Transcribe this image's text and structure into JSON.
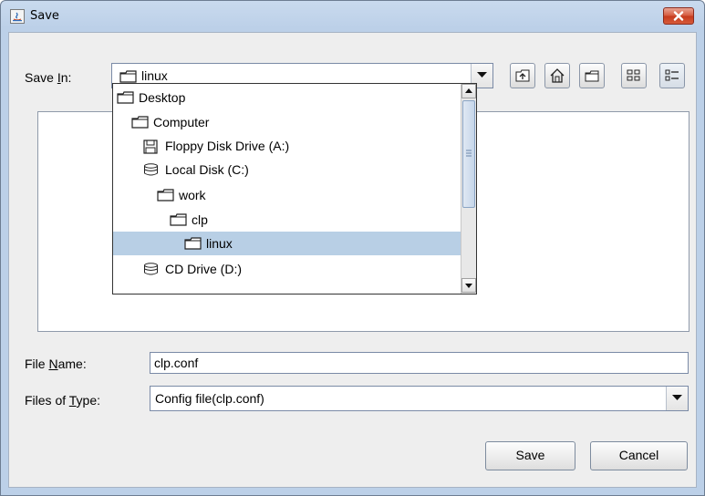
{
  "window": {
    "title": "Save"
  },
  "save_in": {
    "label_prefix": "Save ",
    "label_mnemonic": "I",
    "label_suffix": "n:",
    "value": "linux"
  },
  "toolbar": {
    "icons": [
      "up-one-level-icon",
      "home-icon",
      "new-folder-icon",
      "list-view-icon",
      "details-view-icon"
    ]
  },
  "dropdown": {
    "items": [
      {
        "label": "Desktop",
        "icon": "folder-icon",
        "selected": false
      },
      {
        "label": "Computer",
        "icon": "folder-icon",
        "selected": false
      },
      {
        "label": "Floppy Disk Drive (A:)",
        "icon": "floppy-icon",
        "selected": false
      },
      {
        "label": "Local Disk (C:)",
        "icon": "disk-icon",
        "selected": false
      },
      {
        "label": "work",
        "icon": "folder-icon",
        "selected": false
      },
      {
        "label": "clp",
        "icon": "folder-icon",
        "selected": false
      },
      {
        "label": "linux",
        "icon": "folder-icon",
        "selected": true
      },
      {
        "label": "CD Drive (D:)",
        "icon": "disk-icon",
        "selected": false
      }
    ]
  },
  "file_name": {
    "label_prefix": "File ",
    "label_mnemonic": "N",
    "label_suffix": "ame:",
    "value": "clp.conf"
  },
  "file_type": {
    "label_prefix": "Files of ",
    "label_mnemonic": "T",
    "label_suffix": "ype:",
    "value": "Config file(clp.conf)"
  },
  "buttons": {
    "save": "Save",
    "cancel": "Cancel"
  },
  "colors": {
    "selection": "#b8cfe5",
    "close_button": "#c9452a",
    "dialog_bg": "#eeeeee"
  }
}
